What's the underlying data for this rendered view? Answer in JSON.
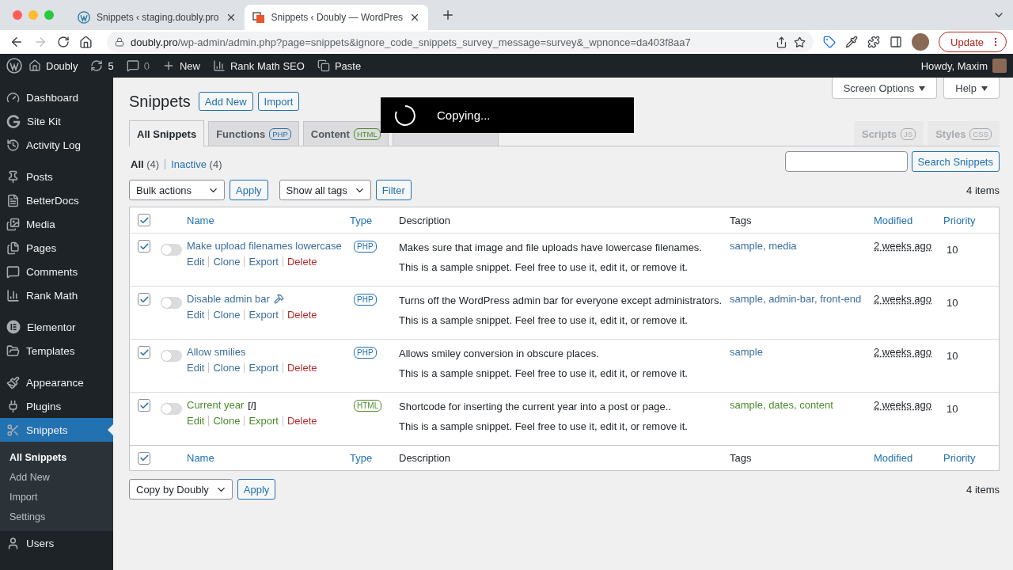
{
  "browser": {
    "tabs": [
      {
        "title": "Snippets ‹ staging.doubly.pro",
        "selected": false,
        "kind": "wp"
      },
      {
        "title": "Snippets ‹ Doubly — WordPres",
        "selected": true,
        "kind": "doubly"
      }
    ],
    "url_host": "doubly.pro",
    "url_path": "/wp-admin/admin.php?page=snippets&ignore_code_snippets_survey_message=survey&_wpnonce=da403f8aa7",
    "update_label": "Update"
  },
  "admin_bar": {
    "items": [
      {
        "label": "Doubly",
        "muted": false
      },
      {
        "label": "5",
        "muted": false
      },
      {
        "label": "0",
        "muted": true
      },
      {
        "label": "New",
        "muted": false
      },
      {
        "label": "Rank Math SEO",
        "muted": false
      },
      {
        "label": "Paste",
        "muted": false
      }
    ],
    "greeting": "Howdy, Maxim"
  },
  "sidebar": {
    "groups": [
      [
        {
          "label": "Dashboard",
          "selected": false
        },
        {
          "label": "Site Kit",
          "selected": false
        },
        {
          "label": "Activity Log",
          "selected": false
        }
      ],
      [
        {
          "label": "Posts",
          "selected": false
        },
        {
          "label": "BetterDocs",
          "selected": false
        },
        {
          "label": "Media",
          "selected": false
        },
        {
          "label": "Pages",
          "selected": false
        },
        {
          "label": "Comments",
          "selected": false
        },
        {
          "label": "Rank Math",
          "selected": false
        }
      ],
      [
        {
          "label": "Elementor",
          "selected": false
        },
        {
          "label": "Templates",
          "selected": false
        }
      ],
      [
        {
          "label": "Appearance",
          "selected": false
        },
        {
          "label": "Plugins",
          "selected": false
        },
        {
          "label": "Snippets",
          "selected": true,
          "children": [
            {
              "label": "All Snippets",
              "selected": true
            },
            {
              "label": "Add New",
              "selected": false
            },
            {
              "label": "Import",
              "selected": false
            },
            {
              "label": "Settings",
              "selected": false
            }
          ]
        },
        {
          "label": "Users",
          "selected": false
        }
      ]
    ]
  },
  "page": {
    "title": "Snippets",
    "title_buttons": [
      "Add New",
      "Import"
    ],
    "meta_buttons": [
      "Screen Options",
      "Help"
    ],
    "tabs": [
      {
        "label": "All Snippets",
        "selected": true
      },
      {
        "label": "Functions",
        "badge": "PHP",
        "selected": false,
        "kind": "php"
      },
      {
        "label": "Content",
        "badge": "HTML",
        "selected": false,
        "kind": "html"
      }
    ],
    "right_tabs": [
      {
        "label": "Scripts",
        "badge": "JS",
        "disabled": true
      },
      {
        "label": "Styles",
        "badge": "CSS",
        "disabled": true
      }
    ],
    "filters": [
      {
        "label": "All",
        "count": "(4)",
        "selected": true
      },
      {
        "label": "Inactive",
        "count": "(4)",
        "selected": false
      }
    ],
    "search_button": "Search Snippets",
    "bulk_select": "Bulk actions",
    "apply": "Apply",
    "tags_select": "Show all tags",
    "filter_button": "Filter",
    "count": "4 items",
    "columns": [
      "Name",
      "Type",
      "Description",
      "Tags",
      "Modified",
      "Priority"
    ],
    "header_checked": true,
    "rows": [
      {
        "checked": true,
        "active": false,
        "kind": "php",
        "name": "Make upload filenames lowercase",
        "pinned": false,
        "actions": [
          "Edit",
          "Clone",
          "Export",
          "Delete"
        ],
        "type": "PHP",
        "description": [
          "Makes sure that image and file uploads have lowercase filenames.",
          "This is a sample snippet. Feel free to use it, edit it, or remove it."
        ],
        "tags": "sample, media",
        "modified": "2 weeks ago",
        "priority": "10"
      },
      {
        "checked": true,
        "active": false,
        "kind": "php",
        "name": "Disable admin bar",
        "pinned": true,
        "actions": [
          "Edit",
          "Clone",
          "Export",
          "Delete"
        ],
        "type": "PHP",
        "description": [
          "Turns off the WordPress admin bar for everyone except administrators.",
          "This is a sample snippet. Feel free to use it, edit it, or remove it."
        ],
        "tags": "sample, admin-bar, front-end",
        "modified": "2 weeks ago",
        "priority": "10"
      },
      {
        "checked": true,
        "active": false,
        "kind": "php",
        "name": "Allow smilies",
        "pinned": false,
        "actions": [
          "Edit",
          "Clone",
          "Export",
          "Delete"
        ],
        "type": "PHP",
        "description": [
          "Allows smiley conversion in obscure places.",
          "This is a sample snippet. Feel free to use it, edit it, or remove it."
        ],
        "tags": "sample",
        "modified": "2 weeks ago",
        "priority": "10"
      },
      {
        "checked": true,
        "active": false,
        "kind": "html",
        "name": "Current year",
        "shortcode": "[/]",
        "pinned": false,
        "actions": [
          "Edit",
          "Clone",
          "Export",
          "Delete"
        ],
        "type": "HTML",
        "description": [
          "Shortcode for inserting the current year into a post or page..",
          "This is a sample snippet. Feel free to use it, edit it, or remove it."
        ],
        "tags": "sample, dates, content",
        "modified": "2 weeks ago",
        "priority": "10"
      }
    ],
    "footer_checked": true,
    "footer_columns": [
      "Name",
      "Type",
      "Description",
      "Tags",
      "Modified",
      "Priority"
    ],
    "bottom_select": "Copy by Doubly",
    "bottom_apply": "Apply",
    "bottom_count": "4 items"
  },
  "toast": {
    "text": "Copying..."
  }
}
